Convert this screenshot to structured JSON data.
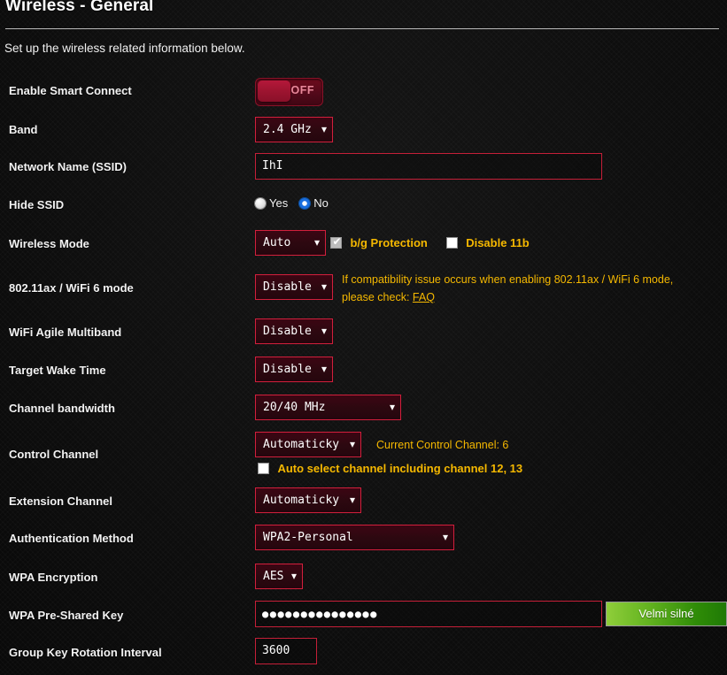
{
  "header": {
    "title": "Wireless - General",
    "description": "Set up the wireless related information below."
  },
  "rows": {
    "smart_connect": {
      "label": "Enable Smart Connect",
      "toggle_state": "OFF"
    },
    "band": {
      "label": "Band",
      "value": "2.4 GHz"
    },
    "ssid": {
      "label": "Network Name (SSID)",
      "value": "IhI"
    },
    "hide_ssid": {
      "label": "Hide SSID",
      "option_yes": "Yes",
      "option_no": "No",
      "selected": "No"
    },
    "wireless_mode": {
      "label": "Wireless Mode",
      "value": "Auto",
      "bg_protection_label": "b/g Protection",
      "bg_protection_checked": true,
      "disable_11b_label": "Disable 11b",
      "disable_11b_checked": false
    },
    "wifi6_mode": {
      "label": "802.11ax / WiFi 6 mode",
      "value": "Disable",
      "hint_line1": "If compatibility issue occurs when enabling 802.11ax / WiFi 6 mode,",
      "hint_line2_prefix": "please check:",
      "hint_link": "FAQ"
    },
    "agile_multiband": {
      "label": "WiFi Agile Multiband",
      "value": "Disable"
    },
    "target_wake_time": {
      "label": "Target Wake Time",
      "value": "Disable"
    },
    "channel_bandwidth": {
      "label": "Channel bandwidth",
      "value": "20/40 MHz"
    },
    "control_channel": {
      "label": "Control Channel",
      "value": "Automaticky",
      "current_channel_text": "Current Control Channel: 6",
      "auto_select_label": "Auto select channel including channel 12, 13",
      "auto_select_checked": false
    },
    "extension_channel": {
      "label": "Extension Channel",
      "value": "Automaticky"
    },
    "auth_method": {
      "label": "Authentication Method",
      "value": "WPA2-Personal"
    },
    "wpa_encryption": {
      "label": "WPA Encryption",
      "value": "AES"
    },
    "psk": {
      "label": "WPA Pre-Shared Key",
      "value": "●●●●●●●●●●●●●●●",
      "strength_badge": "Velmi silné"
    },
    "group_key_rotation": {
      "label": "Group Key Rotation Interval",
      "value": "3600"
    }
  },
  "colors": {
    "accent_red": "#d21f3c",
    "hint_yellow": "#f5b800",
    "badge_green": "#63b320"
  }
}
